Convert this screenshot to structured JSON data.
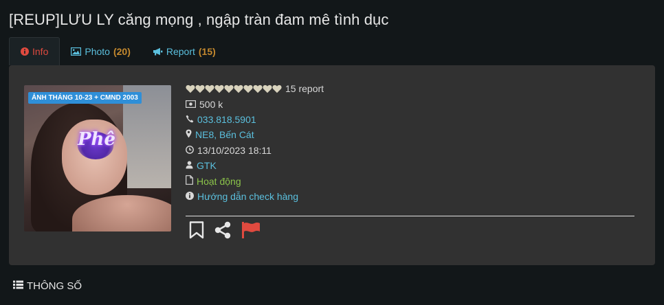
{
  "title": "[REUP]LƯU LY căng mọng , ngập tràn đam mê tình dục",
  "tabs": [
    {
      "label": "Info",
      "count": ""
    },
    {
      "label": "Photo",
      "count": "(20)"
    },
    {
      "label": "Report",
      "count": "(15)"
    }
  ],
  "thumbnail": {
    "badge": "ẢNH THÁNG 10-23 + CMND 2003",
    "overlay_text": "Phê"
  },
  "info": {
    "hearts_count": 10,
    "report": "15 report",
    "price": "500 k",
    "phone": "033.818.5901",
    "location": "NE8, Bến Cát",
    "date": "13/10/2023 18:11",
    "user": "GTK",
    "status": "Hoạt động",
    "guide": "Hướng dẫn check hàng"
  },
  "section": {
    "title": "THÔNG SỐ"
  },
  "colors": {
    "background": "#121719",
    "card": "#313131",
    "link": "#5bc0de",
    "active_tab": "#e04a3f",
    "count": "#c4892e",
    "status_green": "#8bc34a",
    "flag_red": "#e04a3f"
  }
}
